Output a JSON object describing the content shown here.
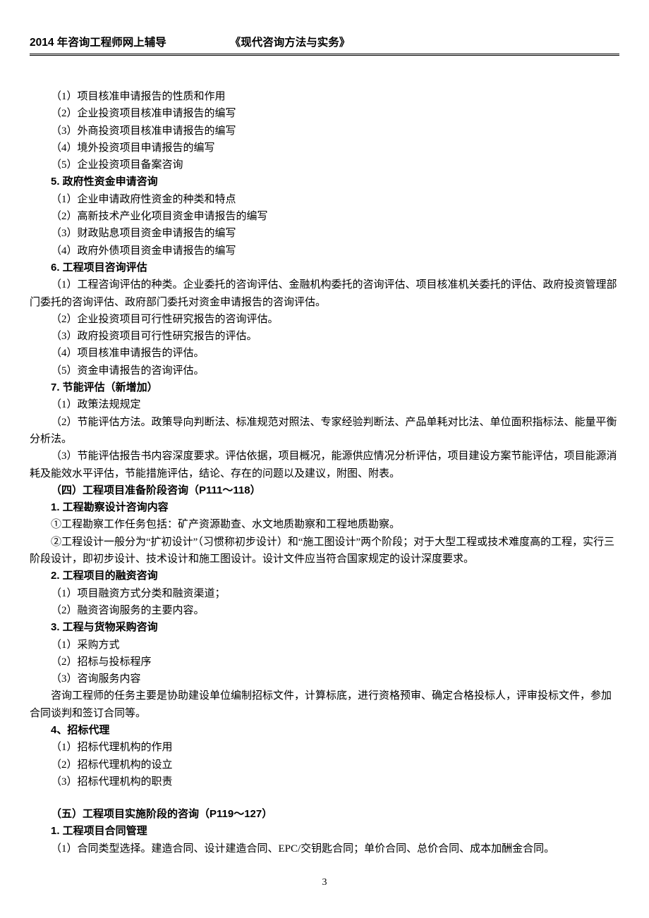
{
  "header": {
    "left": "2014 年咨询工程师网上辅导",
    "right": "《现代咨询方法与实务》"
  },
  "lines": [
    {
      "text": "（1）项目核准申请报告的性质和作用",
      "indent": 1,
      "bold": false
    },
    {
      "text": "（2）企业投资项目核准申请报告的编写",
      "indent": 1,
      "bold": false
    },
    {
      "text": "（3）外商投资项目核准申请报告的编写",
      "indent": 1,
      "bold": false
    },
    {
      "text": "（4）境外投资项目申请报告的编写",
      "indent": 1,
      "bold": false
    },
    {
      "text": "（5）企业投资项目备案咨询",
      "indent": 1,
      "bold": false
    },
    {
      "text": "5. 政府性资金申请咨询",
      "indent": 1,
      "bold": true
    },
    {
      "text": "（1）企业申请政府性资金的种类和特点",
      "indent": 1,
      "bold": false
    },
    {
      "text": "（2）高新技术产业化项目资金申请报告的编写",
      "indent": 1,
      "bold": false
    },
    {
      "text": "（3）财政贴息项目资金申请报告的编写",
      "indent": 1,
      "bold": false
    },
    {
      "text": "（4）政府外债项目资金申请报告的编写",
      "indent": 1,
      "bold": false
    },
    {
      "text": "6. 工程项目咨询评估",
      "indent": 1,
      "bold": true
    },
    {
      "text": "（1）工程咨询评估的种类。企业委托的咨询评估、金融机构委托的咨询评估、项目核准机关委托的评估、政府投资管理部门委托的咨询评估、政府部门委托对资金申请报告的咨询评估。",
      "indent": 1,
      "bold": false
    },
    {
      "text": "（2）企业投资项目可行性研究报告的咨询评估。",
      "indent": 1,
      "bold": false
    },
    {
      "text": "（3）政府投资项目可行性研究报告的评估。",
      "indent": 1,
      "bold": false
    },
    {
      "text": "（4）项目核准申请报告的评估。",
      "indent": 1,
      "bold": false
    },
    {
      "text": "（5）资金申请报告的咨询评估。",
      "indent": 1,
      "bold": false
    },
    {
      "text": "7. 节能评估（新增加）",
      "indent": 1,
      "bold": true
    },
    {
      "text": "（1）政策法规规定",
      "indent": 1,
      "bold": false
    },
    {
      "text": "（2）节能评估方法。政策导向判断法、标准规范对照法、专家经验判断法、产品单耗对比法、单位面积指标法、能量平衡分析法。",
      "indent": 1,
      "bold": false
    },
    {
      "text": "（3）节能评估报告书内容深度要求。评估依据，项目概况，能源供应情况分析评估，项目建设方案节能评估，项目能源消耗及能效水平评估，节能措施评估，结论、存在的问题以及建议，附图、附表。",
      "indent": 1,
      "bold": false
    },
    {
      "text": "（四）工程项目准备阶段咨询（P111～118）",
      "indent": 1,
      "bold": true
    },
    {
      "text": "1. 工程勘察设计咨询内容",
      "indent": 1,
      "bold": true
    },
    {
      "text": "①工程勘察工作任务包括：矿产资源勘查、水文地质勘察和工程地质勘察。",
      "indent": 1,
      "bold": false
    },
    {
      "text": "②工程设计一般分为“扩初设计”（习惯称初步设计）和“施工图设计”两个阶段；对于大型工程或技术难度高的工程，实行三阶段设计，即初步设计、技术设计和施工图设计。设计文件应当符合国家规定的设计深度要求。",
      "indent": 1,
      "bold": false
    },
    {
      "text": "2. 工程项目的融资咨询",
      "indent": 1,
      "bold": true
    },
    {
      "text": "（1）项目融资方式分类和融资渠道；",
      "indent": 1,
      "bold": false
    },
    {
      "text": "（2）融资咨询服务的主要内容。",
      "indent": 1,
      "bold": false
    },
    {
      "text": "3. 工程与货物采购咨询",
      "indent": 1,
      "bold": true
    },
    {
      "text": "（1）采购方式",
      "indent": 1,
      "bold": false
    },
    {
      "text": "（2）招标与投标程序",
      "indent": 1,
      "bold": false
    },
    {
      "text": "（3）咨询服务内容",
      "indent": 1,
      "bold": false
    },
    {
      "text": "咨询工程师的任务主要是协助建设单位编制招标文件，计算标底，进行资格预审、确定合格投标人，评审投标文件，参加合同谈判和签订合同等。",
      "indent": 1,
      "bold": false
    },
    {
      "text": "4、招标代理",
      "indent": 1,
      "bold": true
    },
    {
      "text": "（1）招标代理机构的作用",
      "indent": 1,
      "bold": false
    },
    {
      "text": "（2）招标代理机构的设立",
      "indent": 1,
      "bold": false
    },
    {
      "text": "（3）招标代理机构的职责",
      "indent": 1,
      "bold": false
    },
    {
      "text": "",
      "indent": 0,
      "bold": false,
      "spacer": true
    },
    {
      "text": "（五）工程项目实施阶段的咨询（P119～127）",
      "indent": 1,
      "bold": true
    },
    {
      "text": "1. 工程项目合同管理",
      "indent": 1,
      "bold": true
    },
    {
      "text": "（1）合同类型选择。建造合同、设计建造合同、EPC/交钥匙合同；单价合同、总价合同、成本加酬金合同。",
      "indent": 1,
      "bold": false
    }
  ],
  "page_number": "3"
}
